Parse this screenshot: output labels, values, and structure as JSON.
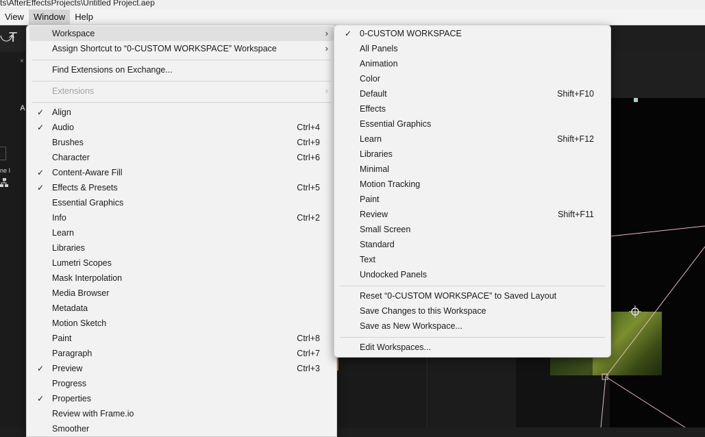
{
  "window": {
    "title": "ts\\AfterEffectsProjects\\Untitled Project.aep"
  },
  "menubar": {
    "items": [
      "View",
      "Window",
      "Help"
    ],
    "active": "Window"
  },
  "background": {
    "tool_glyphs": [
      "⤻",
      "T"
    ],
    "panel_fragment_label": "A",
    "small_fragment_text": "ne I"
  },
  "window_menu": {
    "items": [
      {
        "label": "Workspace",
        "submenu": true,
        "highlighted": true
      },
      {
        "label": "Assign Shortcut to “0-CUSTOM WORKSPACE” Workspace",
        "submenu": true
      },
      {
        "label": "Find Extensions on Exchange..."
      },
      {
        "label": "Extensions",
        "submenu": true,
        "disabled": true
      },
      {
        "label": "Align",
        "checked": true
      },
      {
        "label": "Audio",
        "checked": true,
        "shortcut": "Ctrl+4"
      },
      {
        "label": "Brushes",
        "shortcut": "Ctrl+9"
      },
      {
        "label": "Character",
        "shortcut": "Ctrl+6"
      },
      {
        "label": "Content-Aware Fill",
        "checked": true
      },
      {
        "label": "Effects & Presets",
        "checked": true,
        "shortcut": "Ctrl+5"
      },
      {
        "label": "Essential Graphics"
      },
      {
        "label": "Info",
        "shortcut": "Ctrl+2"
      },
      {
        "label": "Learn"
      },
      {
        "label": "Libraries"
      },
      {
        "label": "Lumetri Scopes"
      },
      {
        "label": "Mask Interpolation"
      },
      {
        "label": "Media Browser"
      },
      {
        "label": "Metadata"
      },
      {
        "label": "Motion Sketch"
      },
      {
        "label": "Paint",
        "shortcut": "Ctrl+8"
      },
      {
        "label": "Paragraph",
        "shortcut": "Ctrl+7"
      },
      {
        "label": "Preview",
        "checked": true,
        "shortcut": "Ctrl+3"
      },
      {
        "label": "Progress"
      },
      {
        "label": "Properties",
        "checked": true
      },
      {
        "label": "Review with Frame.io"
      },
      {
        "label": "Smoother"
      }
    ],
    "checkmark": "✓",
    "submenu_arrow": "›"
  },
  "workspace_submenu": {
    "items": [
      {
        "label": "0-CUSTOM WORKSPACE",
        "checked": true
      },
      {
        "label": "All Panels"
      },
      {
        "label": "Animation"
      },
      {
        "label": "Color"
      },
      {
        "label": "Default",
        "shortcut": "Shift+F10"
      },
      {
        "label": "Effects"
      },
      {
        "label": "Essential Graphics"
      },
      {
        "label": "Learn",
        "shortcut": "Shift+F12"
      },
      {
        "label": "Libraries"
      },
      {
        "label": "Minimal"
      },
      {
        "label": "Motion Tracking"
      },
      {
        "label": "Paint"
      },
      {
        "label": "Review",
        "shortcut": "Shift+F11"
      },
      {
        "label": "Small Screen"
      },
      {
        "label": "Standard"
      },
      {
        "label": "Text"
      },
      {
        "label": "Undocked Panels"
      },
      {
        "label": "Reset “0-CUSTOM WORKSPACE” to Saved Layout"
      },
      {
        "label": "Save Changes to this Workspace"
      },
      {
        "label": "Save as New Workspace..."
      },
      {
        "label": "Edit Workspaces..."
      }
    ]
  },
  "colors": {
    "menu_bg": "#f2f2f2",
    "highlight": "#e0e0e0",
    "app_dark": "#1e1e1e",
    "accent_orange": "#d38a1f"
  }
}
